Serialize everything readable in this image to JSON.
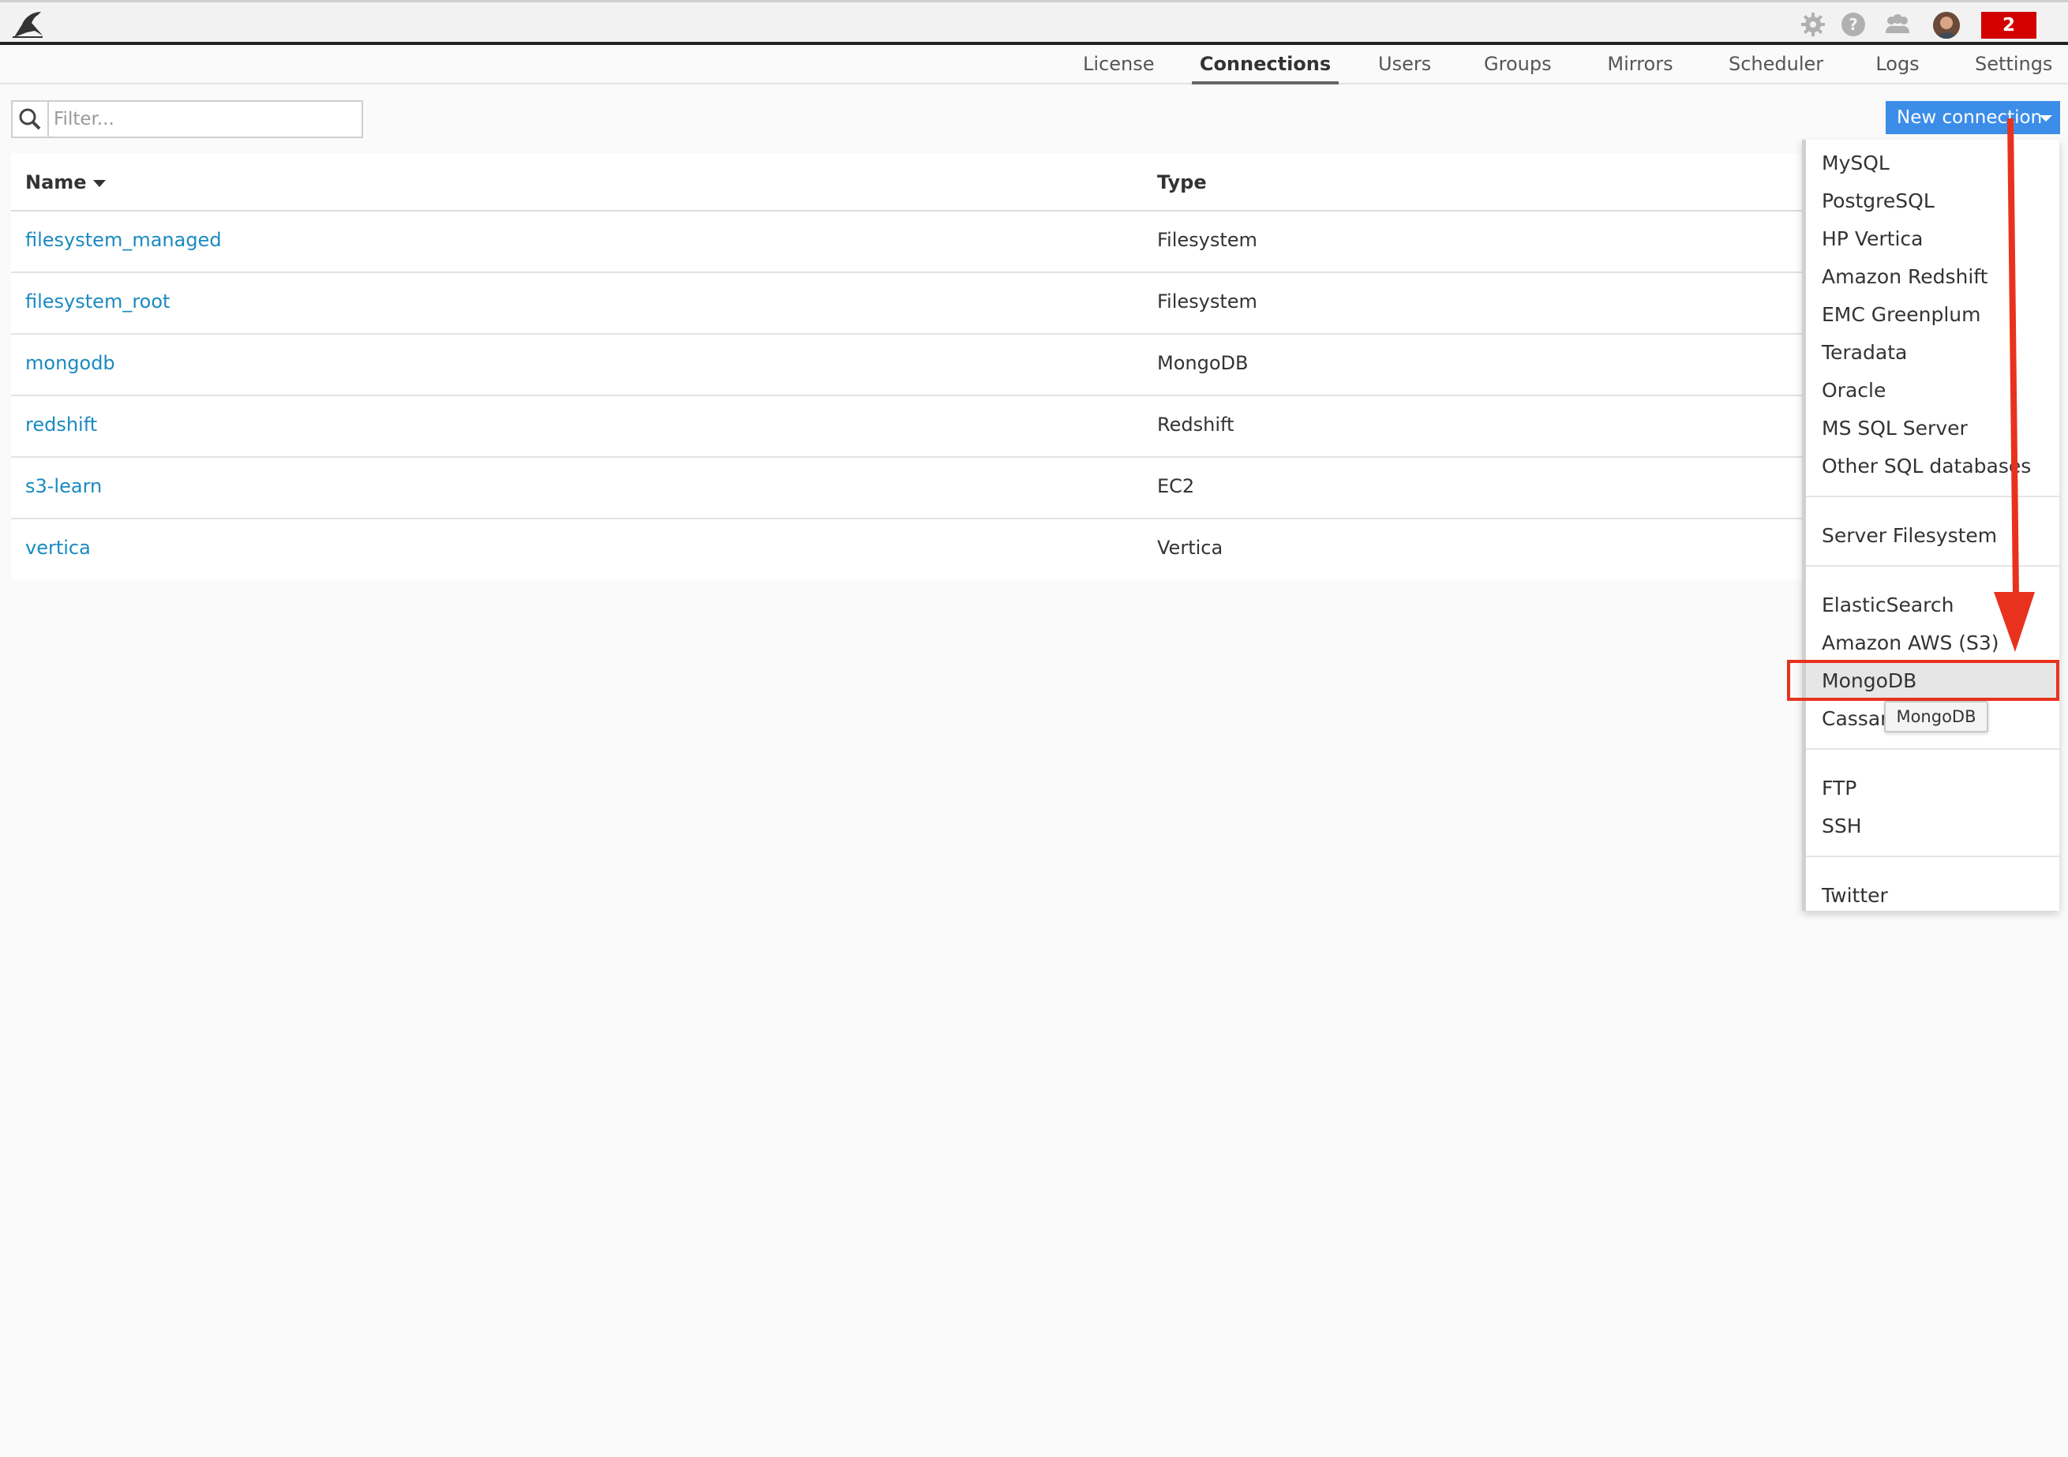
{
  "header": {
    "notification_count": "2",
    "icons": [
      "bird-logo",
      "gear-icon",
      "help-icon",
      "users-icon",
      "avatar"
    ]
  },
  "nav": {
    "tabs": [
      {
        "label": "License"
      },
      {
        "label": "Connections",
        "active": true
      },
      {
        "label": "Users"
      },
      {
        "label": "Groups"
      },
      {
        "label": "Mirrors"
      },
      {
        "label": "Scheduler"
      },
      {
        "label": "Logs"
      },
      {
        "label": "Settings"
      }
    ]
  },
  "filter": {
    "placeholder": "Filter..."
  },
  "table": {
    "headers": {
      "name": "Name",
      "type": "Type"
    },
    "rows": [
      {
        "name": "filesystem_managed",
        "type": "Filesystem"
      },
      {
        "name": "filesystem_root",
        "type": "Filesystem"
      },
      {
        "name": "mongodb",
        "type": "MongoDB"
      },
      {
        "name": "redshift",
        "type": "Redshift"
      },
      {
        "name": "s3-learn",
        "type": "EC2"
      },
      {
        "name": "vertica",
        "type": "Vertica"
      }
    ]
  },
  "new_connection": {
    "label": "New connection",
    "menu": [
      "MySQL",
      "PostgreSQL",
      "HP Vertica",
      "Amazon Redshift",
      "EMC Greenplum",
      "Teradata",
      "Oracle",
      "MS SQL Server",
      "Other SQL databases",
      "Server Filesystem",
      "ElasticSearch",
      "Amazon AWS (S3)",
      "MongoDB",
      "Cassandra",
      "FTP",
      "SSH",
      "Twitter"
    ],
    "highlighted": "MongoDB",
    "tooltip": "MongoDB"
  },
  "colors": {
    "accent": "#3b8de8",
    "link": "#1a8ac0",
    "notification": "#d20000",
    "annotation": "#e8321e"
  }
}
